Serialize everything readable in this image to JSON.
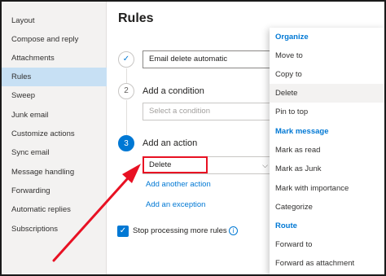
{
  "sidebar": {
    "items": [
      {
        "label": "Layout"
      },
      {
        "label": "Compose and reply"
      },
      {
        "label": "Attachments"
      },
      {
        "label": "Rules",
        "active": true
      },
      {
        "label": "Sweep"
      },
      {
        "label": "Junk email"
      },
      {
        "label": "Customize actions"
      },
      {
        "label": "Sync email"
      },
      {
        "label": "Message handling"
      },
      {
        "label": "Forwarding"
      },
      {
        "label": "Automatic replies"
      },
      {
        "label": "Subscriptions"
      }
    ]
  },
  "main": {
    "title": "Rules",
    "step1": {
      "check": "✓",
      "rule_name_value": "Email delete automatic"
    },
    "step2": {
      "number": "2",
      "label": "Add a condition",
      "select_placeholder": "Select a condition"
    },
    "step3": {
      "number": "3",
      "label": "Add an action",
      "select_value": "Delete",
      "chevron": "⌵"
    },
    "add_another_action": "Add another action",
    "add_exception": "Add an exception",
    "stop_processing": {
      "checked": true,
      "check": "✓",
      "label": "Stop processing more rules",
      "info": "i"
    }
  },
  "dropdown": {
    "items": [
      {
        "label": "Organize",
        "type": "header"
      },
      {
        "label": "Move to"
      },
      {
        "label": "Copy to"
      },
      {
        "label": "Delete",
        "selected": true
      },
      {
        "label": "Pin to top"
      },
      {
        "label": "Mark message",
        "type": "header"
      },
      {
        "label": "Mark as read"
      },
      {
        "label": "Mark as Junk"
      },
      {
        "label": "Mark with importance"
      },
      {
        "label": "Categorize"
      },
      {
        "label": "Route",
        "type": "header"
      },
      {
        "label": "Forward to"
      },
      {
        "label": "Forward as attachment"
      }
    ]
  },
  "colors": {
    "accent": "#0078d4",
    "sidebar_active": "#c7e0f4",
    "annotation": "#e81123"
  }
}
